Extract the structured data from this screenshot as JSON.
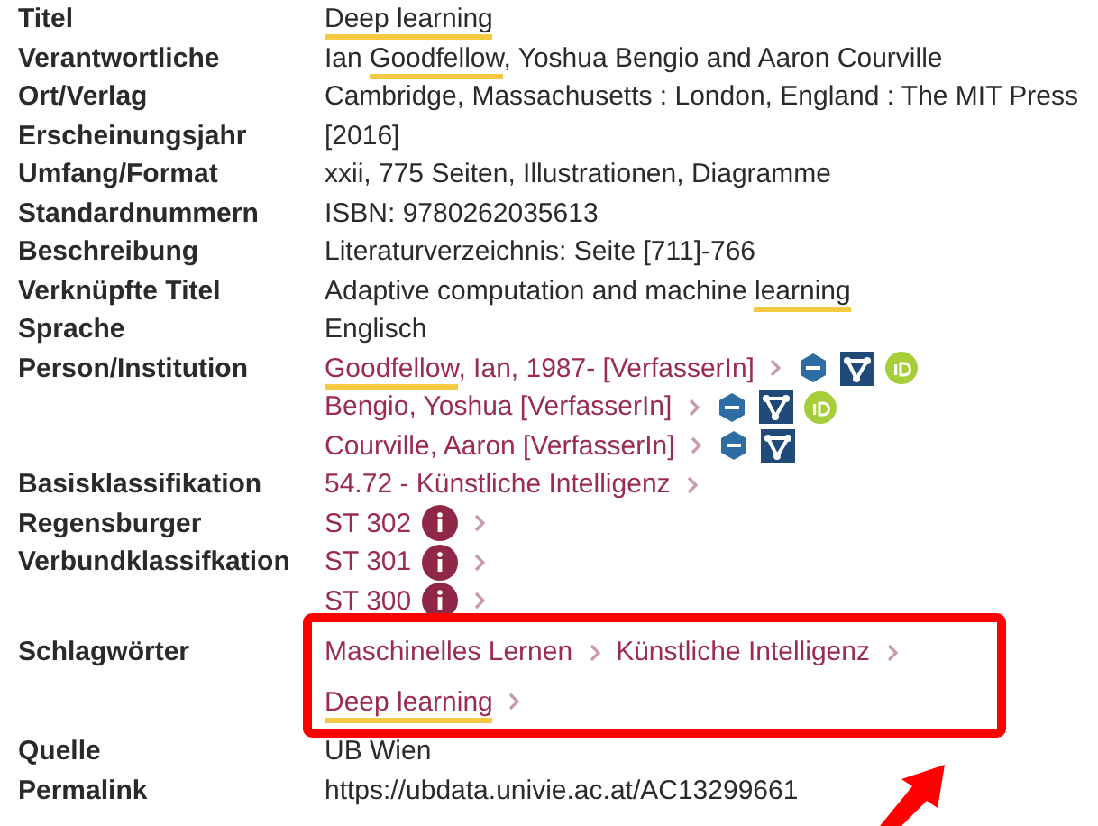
{
  "rows": [
    {
      "label": "Titel",
      "lines": [
        {
          "segments": [
            {
              "text": "Deep learning",
              "highlight": true
            }
          ]
        }
      ]
    },
    {
      "label": "Verantwortliche",
      "lines": [
        {
          "segments": [
            {
              "text": "Ian ",
              "highlight": false
            },
            {
              "text": "Goodfellow",
              "highlight": true
            },
            {
              "text": ", Yoshua Bengio and Aaron Courville",
              "highlight": false
            }
          ]
        }
      ]
    },
    {
      "label": "Ort/Verlag",
      "lines": [
        {
          "segments": [
            {
              "text": "Cambridge, Massachusetts : London, England : The MIT Press",
              "highlight": false
            }
          ]
        }
      ]
    },
    {
      "label": "Erscheinungsjahr",
      "lines": [
        {
          "segments": [
            {
              "text": "[2016]",
              "highlight": false
            }
          ]
        }
      ]
    },
    {
      "label": "Umfang/Format",
      "lines": [
        {
          "segments": [
            {
              "text": "xxii, 775 Seiten, Illustrationen, Diagramme",
              "highlight": false
            }
          ]
        }
      ]
    },
    {
      "label": "Standardnummern",
      "lines": [
        {
          "segments": [
            {
              "text": "ISBN: 9780262035613",
              "highlight": false
            }
          ]
        }
      ]
    },
    {
      "label": "Beschreibung",
      "lines": [
        {
          "segments": [
            {
              "text": "Literaturverzeichnis: Seite [711]-766",
              "highlight": false
            }
          ]
        }
      ]
    },
    {
      "label": "Verknüpfte Titel",
      "lines": [
        {
          "segments": [
            {
              "text": "Adaptive computation and machine ",
              "highlight": false
            },
            {
              "text": "learning",
              "highlight": true
            }
          ]
        }
      ]
    },
    {
      "label": "Sprache",
      "lines": [
        {
          "segments": [
            {
              "text": "Englisch",
              "highlight": false
            }
          ]
        }
      ]
    },
    {
      "label": "Person/Institution",
      "lines": [
        {
          "link": true,
          "chevron": true,
          "gnd": true,
          "network": true,
          "orcid": true,
          "segments": [
            {
              "text": "Goodfellow",
              "highlight": true
            },
            {
              "text": ", Ian, 1987- [VerfasserIn]",
              "highlight": false
            }
          ]
        },
        {
          "link": true,
          "chevron": true,
          "gnd": true,
          "network": true,
          "orcid": true,
          "segments": [
            {
              "text": "Bengio, Yoshua [VerfasserIn]",
              "highlight": false
            }
          ]
        },
        {
          "link": true,
          "chevron": true,
          "gnd": true,
          "network": true,
          "orcid": false,
          "segments": [
            {
              "text": "Courville, Aaron [VerfasserIn]",
              "highlight": false
            }
          ]
        }
      ]
    },
    {
      "label": "Basisklassifikation",
      "lines": [
        {
          "link": true,
          "chevron": true,
          "segments": [
            {
              "text": "54.72 - Künstliche Intelligenz",
              "highlight": false
            }
          ]
        }
      ]
    },
    {
      "label": "Regensburger Verbundklassifkation",
      "lines": [
        {
          "link": true,
          "chevron": true,
          "info": true,
          "segments": [
            {
              "text": "ST 302",
              "highlight": false
            }
          ]
        },
        {
          "link": true,
          "chevron": true,
          "info": true,
          "segments": [
            {
              "text": "ST 301",
              "highlight": false
            }
          ]
        },
        {
          "link": true,
          "chevron": true,
          "info": true,
          "segments": [
            {
              "text": "ST 300",
              "highlight": false
            }
          ]
        }
      ]
    },
    {
      "label": "Schlagwörter",
      "boxed": true,
      "lines": [
        {
          "link": true,
          "chevron": true,
          "segments": [
            {
              "text": "Maschinelles Lernen",
              "highlight": false
            }
          ]
        },
        {
          "link": true,
          "chevron": true,
          "segments": [
            {
              "text": "Künstliche Intelligenz",
              "highlight": false
            }
          ]
        },
        {
          "link": true,
          "chevron": true,
          "segments": [
            {
              "text": "Deep learning",
              "highlight": true
            }
          ]
        }
      ]
    },
    {
      "label": "Quelle",
      "lines": [
        {
          "segments": [
            {
              "text": "UB Wien",
              "highlight": false
            }
          ]
        }
      ]
    },
    {
      "label": "Permalink",
      "lines": [
        {
          "segments": [
            {
              "text": "https://ubdata.univie.ac.at/AC13299661",
              "highlight": false
            }
          ]
        }
      ]
    }
  ]
}
